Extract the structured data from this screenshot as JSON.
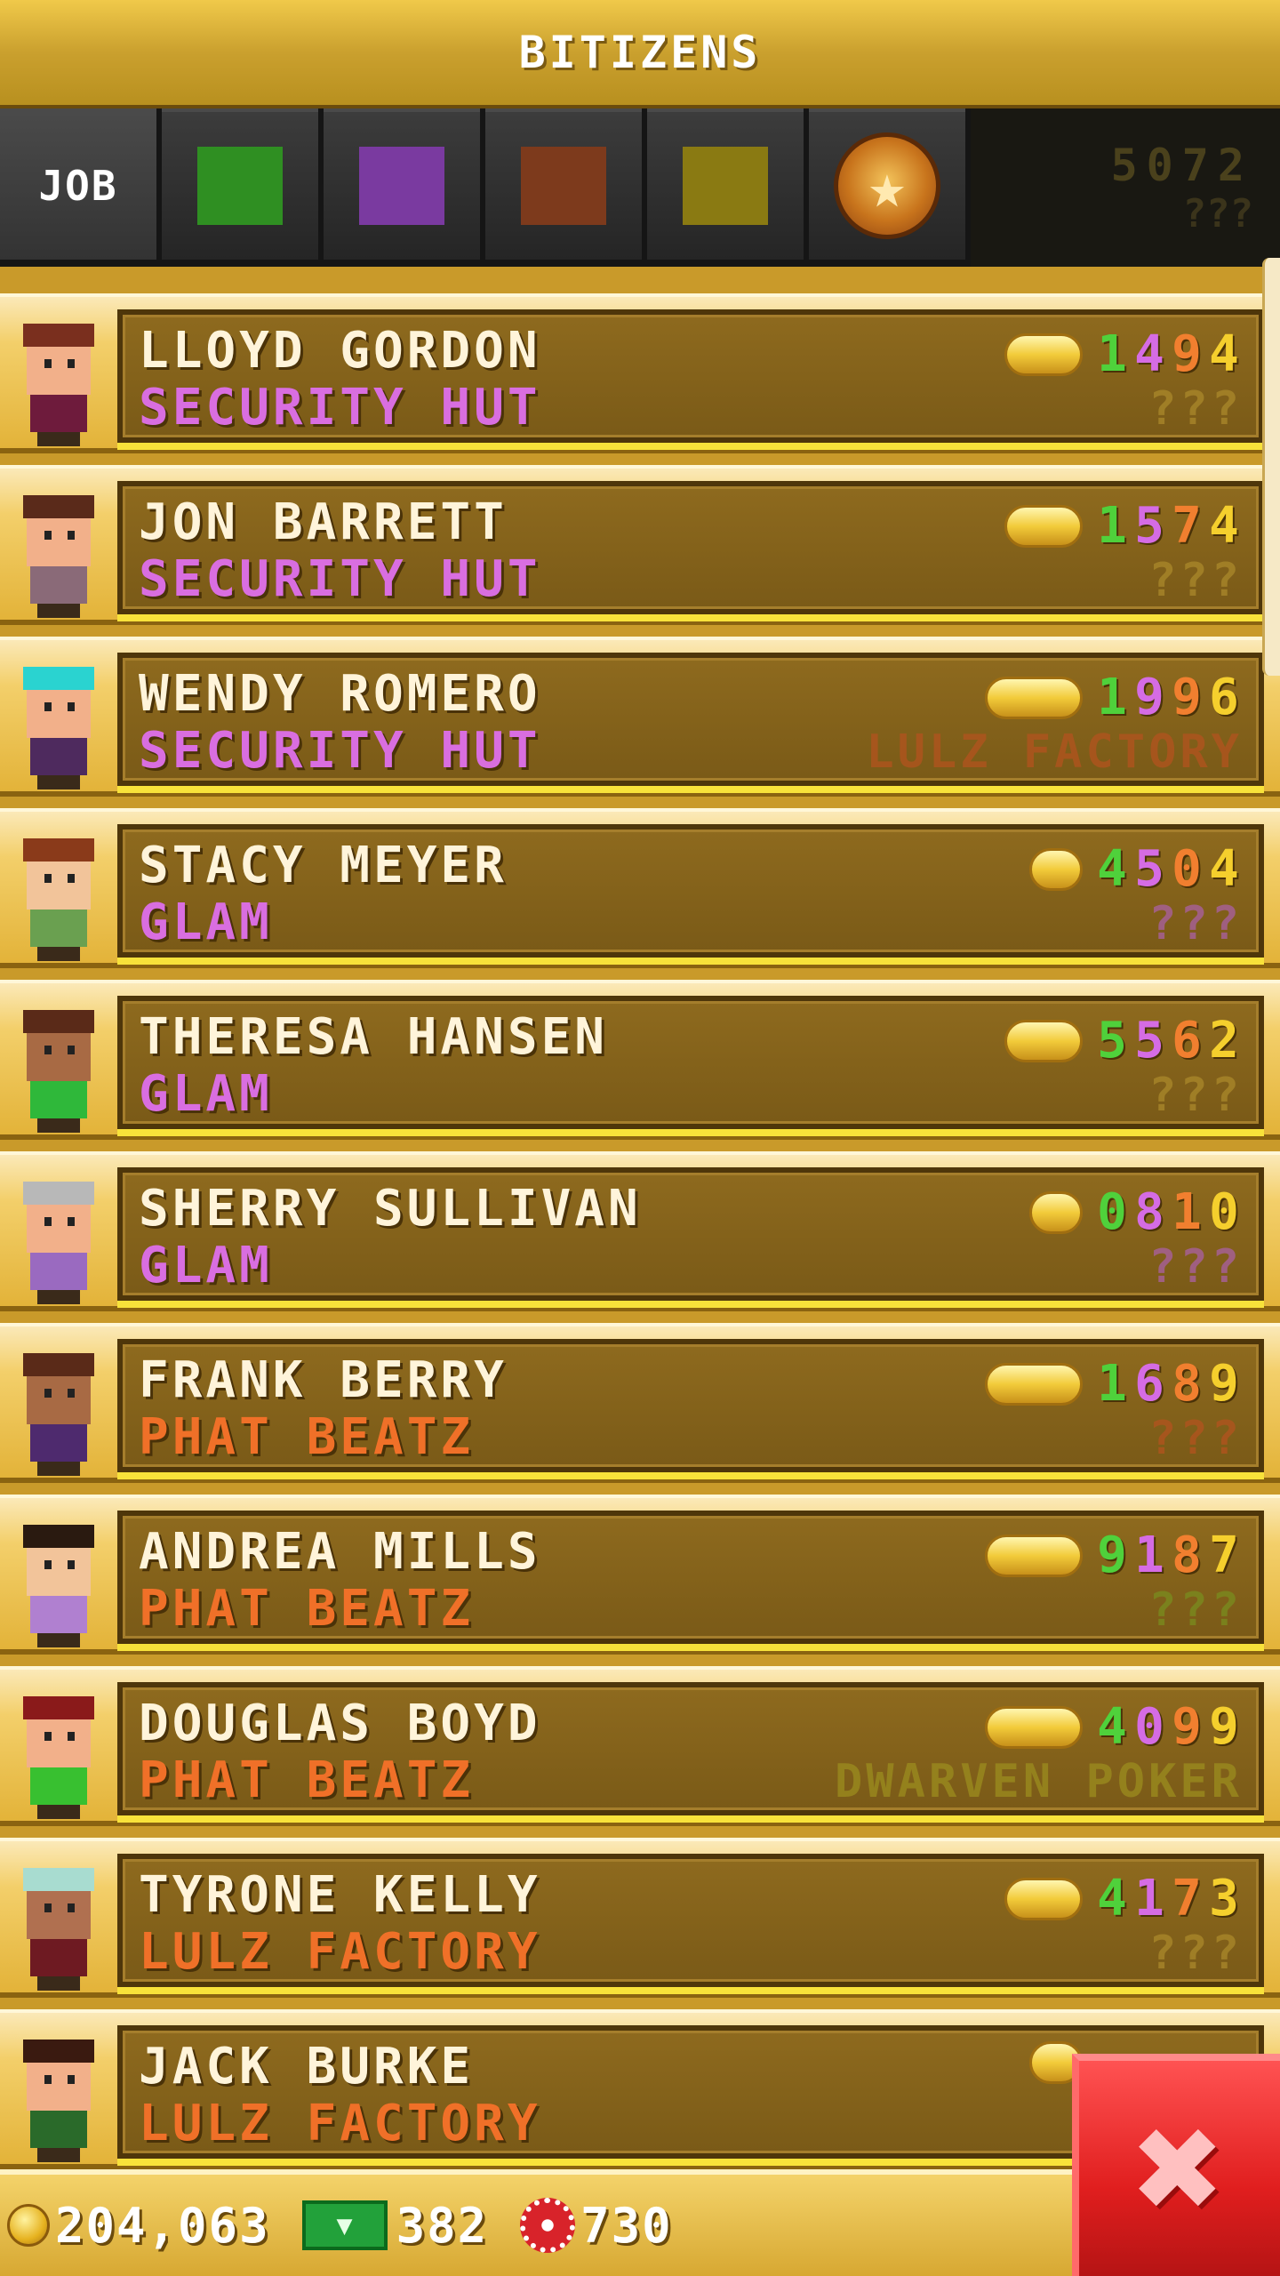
{
  "header": {
    "title": "BITIZENS"
  },
  "tabs": {
    "job_label": "JOB",
    "swatches": [
      {
        "name": "filter-food",
        "color": "#2f8f22"
      },
      {
        "name": "filter-service",
        "color": "#7a3aa0"
      },
      {
        "name": "filter-recreation",
        "color": "#7d3a1c"
      },
      {
        "name": "filter-retail",
        "color": "#8a7a12"
      }
    ],
    "special_icon": "star-badge-icon",
    "summary_digits": "5072",
    "summary_dream": "???"
  },
  "colors": {
    "job_security": "#d96ee0",
    "job_glam": "#d96ee0",
    "job_phat": "#f07028",
    "job_lulz": "#f07028",
    "digit_1": "#4fd13b",
    "digit_2": "#d56ce4",
    "digit_3": "#f17f2f",
    "digit_4": "#f5cf2d"
  },
  "bitizens": [
    {
      "name": "LLOYD GORDON",
      "job": "SECURITY HUT",
      "digits": [
        "1",
        "4",
        "9",
        "4"
      ],
      "dream": "???",
      "dream_color": "#a8862a",
      "skin": "#f2b08a",
      "hair": "#7a2f1e",
      "shirt": "#6e1b3c",
      "coin_width": 88
    },
    {
      "name": "JON BARRETT",
      "job": "SECURITY HUT",
      "digits": [
        "1",
        "5",
        "7",
        "4"
      ],
      "dream": "???",
      "dream_color": "#a8862a",
      "skin": "#f2b08a",
      "hair": "#5a2a1a",
      "shirt": "#8a6a78",
      "coin_width": 88
    },
    {
      "name": "WENDY ROMERO",
      "job": "SECURITY HUT",
      "digits": [
        "1",
        "9",
        "9",
        "6"
      ],
      "dream": "LULZ FACTORY",
      "dream_color": "#b0541e",
      "skin": "#f2b08a",
      "hair": "#2ad3d0",
      "shirt": "#4e2a5e",
      "coin_width": 110
    },
    {
      "name": "STACY MEYER",
      "job": "GLAM",
      "digits": [
        "4",
        "5",
        "0",
        "4"
      ],
      "dream": "???",
      "dream_color": "#a8609a",
      "skin": "#f2c49a",
      "hair": "#8a3a1a",
      "shirt": "#6aa050",
      "coin_width": 60
    },
    {
      "name": "THERESA HANSEN",
      "job": "GLAM",
      "digits": [
        "5",
        "5",
        "6",
        "2"
      ],
      "dream": "???",
      "dream_color": "#a8862a",
      "skin": "#a86a44",
      "hair": "#5a2a18",
      "shirt": "#2fb83a",
      "coin_width": 88
    },
    {
      "name": "SHERRY SULLIVAN",
      "job": "GLAM",
      "digits": [
        "0",
        "8",
        "1",
        "0"
      ],
      "dream": "???",
      "dream_color": "#a8609a",
      "skin": "#f2b08a",
      "hair": "#b8b8b8",
      "shirt": "#9a6ac0",
      "coin_width": 60
    },
    {
      "name": "FRANK BERRY",
      "job": "PHAT BEATZ",
      "digits": [
        "1",
        "6",
        "8",
        "9"
      ],
      "dream": "???",
      "dream_color": "#b0541e",
      "skin": "#a86a44",
      "hair": "#5a2a18",
      "shirt": "#4e2a6e",
      "coin_width": 110
    },
    {
      "name": "ANDREA MILLS",
      "job": "PHAT BEATZ",
      "digits": [
        "9",
        "1",
        "8",
        "7"
      ],
      "dream": "???",
      "dream_color": "#7a8a1e",
      "skin": "#f2c49a",
      "hair": "#2a1a10",
      "shirt": "#b080d0",
      "coin_width": 110
    },
    {
      "name": "DOUGLAS BOYD",
      "job": "PHAT BEATZ",
      "digits": [
        "4",
        "0",
        "9",
        "9"
      ],
      "dream": "DWARVEN POKER",
      "dream_color": "#9a8a1e",
      "skin": "#f2b08a",
      "hair": "#8a1a1a",
      "shirt": "#38c030",
      "coin_width": 110
    },
    {
      "name": "TYRONE KELLY",
      "job": "LULZ FACTORY",
      "digits": [
        "4",
        "1",
        "7",
        "3"
      ],
      "dream": "???",
      "dream_color": "#a8862a",
      "skin": "#b07050",
      "hair": "#a8dcd0",
      "shirt": "#6e1a22",
      "coin_width": 88
    },
    {
      "name": "JACK BURKE",
      "job": "LULZ FACTORY",
      "digits": [
        "",
        "",
        "",
        ""
      ],
      "dream": "",
      "dream_color": "#a8862a",
      "skin": "#f2b08a",
      "hair": "#3a1a10",
      "shirt": "#2a6a2a",
      "coin_width": 60
    }
  ],
  "footer": {
    "coins": "204,063",
    "bux": "382",
    "tickets": "730"
  },
  "close_label": "✖"
}
